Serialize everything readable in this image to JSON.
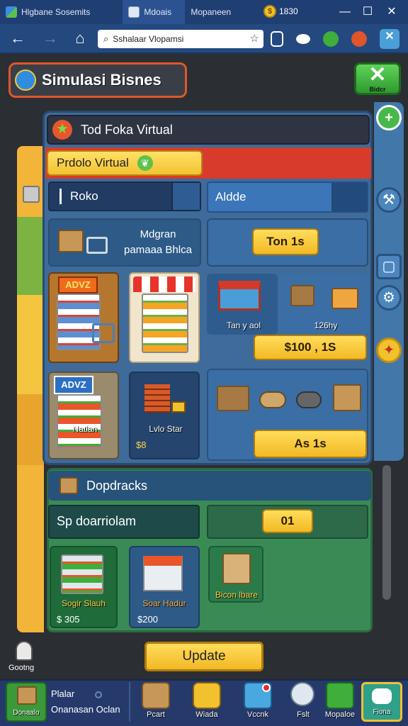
{
  "browser": {
    "tabs": [
      {
        "label": "Hlgbane Sosemits"
      },
      {
        "label": "Mdoais"
      },
      {
        "label": "Mopaneen"
      }
    ],
    "coin_value": "1830",
    "nav": {
      "back": "←",
      "forward": "→",
      "home": "⌂"
    },
    "url": "Sshalaar Vlopamsi"
  },
  "game": {
    "title": "Simulasi Bisnes",
    "close_label": "Bidcr",
    "store_title": "Tod Foka Virtual",
    "product_tab": "Prdolo Virtual",
    "field_name": "Roko",
    "field_mode": "Aldde",
    "package": {
      "line1": "Mdgran",
      "line2": "pamaaa Bhlca"
    },
    "time_button": "Ton 1s",
    "tile_label_1": "Tan y aol",
    "tile_label_2": "126hy",
    "price_button": "$100 , 1S",
    "shop_name": "Natlan",
    "stall": {
      "label": "Lvlo Star",
      "price": "$8"
    },
    "as_button": "As   1s",
    "dropdown_title": "Dopdracks",
    "sp_label": "Sp doarriolam",
    "count_value": "01",
    "items": [
      {
        "label": "Sogir Slauh",
        "price": "$ 305"
      },
      {
        "label": "Soar Hadur",
        "price": "$200"
      },
      {
        "label": "Bicon lbare",
        "price": ""
      }
    ],
    "update_button": "Update",
    "side_label": "Gootng",
    "bottom_nav": [
      {
        "label": "Donaalo"
      },
      {
        "label": "Pcart"
      },
      {
        "label": "Wiada"
      },
      {
        "label": "Vccnk"
      },
      {
        "label": "Fslt"
      },
      {
        "label": "Mopaloe"
      },
      {
        "label": "Fiona"
      }
    ],
    "bottom_info": {
      "line1": "Plalar",
      "line2": "Onanasan Oclan"
    }
  }
}
